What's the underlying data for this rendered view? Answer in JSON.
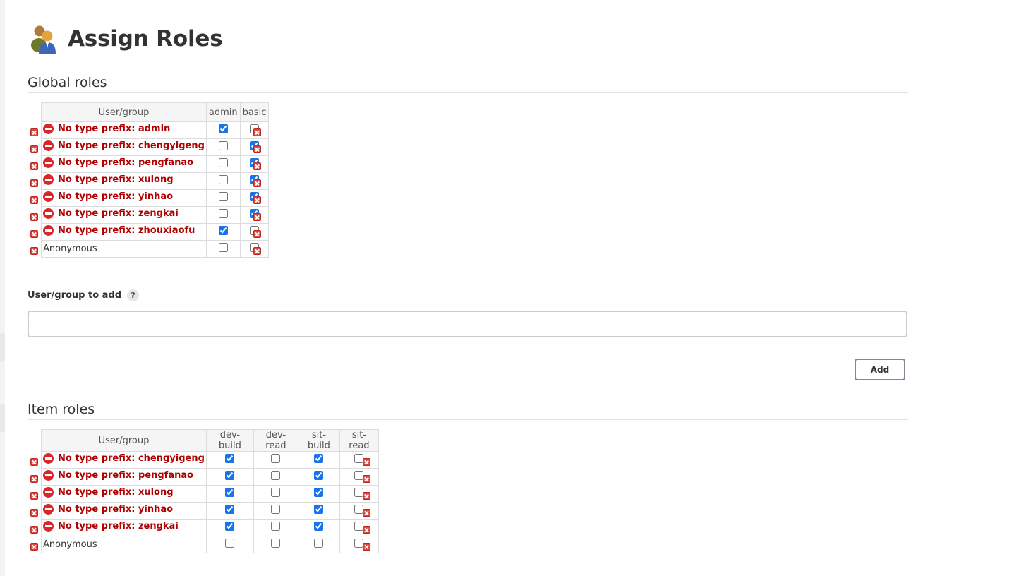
{
  "page": {
    "title": "Assign Roles"
  },
  "global_roles": {
    "title": "Global roles",
    "header": "User/group",
    "roles": [
      "admin",
      "basic"
    ],
    "rows": [
      {
        "name": "admin",
        "warning": true,
        "checks": [
          true,
          false
        ]
      },
      {
        "name": "chengyigeng",
        "warning": true,
        "checks": [
          false,
          true
        ]
      },
      {
        "name": "pengfanao",
        "warning": true,
        "checks": [
          false,
          true
        ]
      },
      {
        "name": "xulong",
        "warning": true,
        "checks": [
          false,
          true
        ]
      },
      {
        "name": "yinhao",
        "warning": true,
        "checks": [
          false,
          true
        ]
      },
      {
        "name": "zengkai",
        "warning": true,
        "checks": [
          false,
          true
        ]
      },
      {
        "name": "zhouxiaofu",
        "warning": true,
        "checks": [
          true,
          false
        ]
      },
      {
        "name": "Anonymous",
        "warning": false,
        "checks": [
          false,
          false
        ]
      }
    ]
  },
  "add_user": {
    "label": "User/group to add",
    "help": "?",
    "value": "",
    "button_label": "Add"
  },
  "item_roles": {
    "title": "Item roles",
    "header": "User/group",
    "roles": [
      "dev-build",
      "dev-read",
      "sit-build",
      "sit-read"
    ],
    "rows": [
      {
        "name": "chengyigeng",
        "warning": true,
        "checks": [
          true,
          false,
          true,
          false
        ]
      },
      {
        "name": "pengfanao",
        "warning": true,
        "checks": [
          true,
          false,
          true,
          false
        ]
      },
      {
        "name": "xulong",
        "warning": true,
        "checks": [
          true,
          false,
          true,
          false
        ]
      },
      {
        "name": "yinhao",
        "warning": true,
        "checks": [
          true,
          false,
          true,
          false
        ]
      },
      {
        "name": "zengkai",
        "warning": true,
        "checks": [
          true,
          false,
          true,
          false
        ]
      },
      {
        "name": "Anonymous",
        "warning": false,
        "checks": [
          false,
          false,
          false,
          false
        ]
      }
    ]
  },
  "warning_prefix": "No type prefix: ",
  "icons": {
    "title": "users-group-icon",
    "delete": "delete-icon",
    "warning": "no-entry-icon",
    "help": "help-icon"
  },
  "colors": {
    "warning_text": "#b00000",
    "delete": "#e1463b",
    "checkbox": "#1a73e8"
  }
}
